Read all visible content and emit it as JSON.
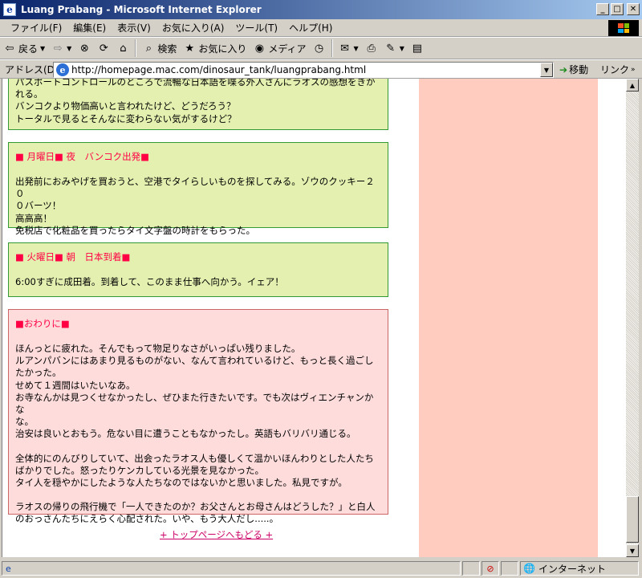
{
  "window": {
    "title": "Luang Prabang - Microsoft Internet Explorer"
  },
  "menu": [
    "ファイル(F)",
    "編集(E)",
    "表示(V)",
    "お気に入り(A)",
    "ツール(T)",
    "ヘルプ(H)"
  ],
  "toolbar": {
    "back": "戻る",
    "search": "検索",
    "favorites": "お気に入り",
    "media": "メディア"
  },
  "address": {
    "label": "アドレス(D)",
    "url": "http://homepage.mac.com/dinosaur_tank/luangprabang.html",
    "go": "移動",
    "links": "リンク"
  },
  "content": {
    "box0": {
      "lines": [
        "パスポートコントロールのところで流暢な日本語を喋る外人さんにラオスの感想をきか",
        "れる。",
        "バンコクより物価高いと言われたけど、どうだろう？",
        "トータルで見るとそんなに変わらない気がするけど？"
      ]
    },
    "box1": {
      "heading": "■ 月曜日■ 夜　バンコク出発■",
      "lines": [
        "出発前におみやげを買おうと、空港でタイらしいものを探してみる。ゾウのクッキー２０",
        "０バーツ！",
        "高高高！",
        "免税店で化粧品を買ったらタイ文字盤の時計をもらった。"
      ]
    },
    "box2": {
      "heading": "■ 火曜日■ 朝　日本到着■",
      "lines": [
        "6:00すぎに成田着。到着して、このまま仕事へ向かう。イェア！"
      ]
    },
    "box3": {
      "heading": "■おわりに■",
      "para1": [
        "ほんっとに疲れた。そんでもって物足りなさがいっぱい残りました。",
        "ルアンパバンにはあまり見るものがない、なんて言われているけど、もっと長く過ごし",
        "たかった。",
        "せめて１週間はいたいなあ。",
        "お寺なんかは見つくせなかったし、ぜひまた行きたいです。でも次はヴィエンチャンかな",
        "な。",
        "治安は良いとおもう。危ない目に遭うこともなかったし。英語もバリバリ通じる。"
      ],
      "para2": [
        "全体的にのんびりしていて、出会ったラオス人も優しくて温かいほんわりとした人たち",
        "ばかりでした。怒ったりケンカしている光景を見なかった。",
        "タイ人を穏やかにしたような人たちなのではないかと思いました。私見ですが。"
      ],
      "para3": [
        "ラオスの帰りの飛行機で「一人できたのか？お父さんとお母さんはどうした？」と白人",
        "のおっさんたちにえらく心配された。いや、もう大人だし.....。"
      ]
    },
    "top_link": "+ トップページへもどる +"
  },
  "status": {
    "zone": "インターネット"
  },
  "colors": {
    "green_box": "#e4f0b0",
    "pink_box": "#ffdcdc",
    "side_column": "#ffccbf",
    "heading": "#ff0044",
    "link": "#cc0066"
  },
  "icons": [
    "ie-icon",
    "back-arrow-icon",
    "forward-arrow-icon",
    "stop-icon",
    "refresh-icon",
    "home-icon",
    "search-icon",
    "favorites-icon",
    "media-icon",
    "history-icon",
    "mail-icon",
    "print-icon",
    "edit-icon",
    "discuss-icon",
    "go-arrow-icon",
    "windows-logo-icon",
    "security-icon",
    "globe-icon"
  ]
}
